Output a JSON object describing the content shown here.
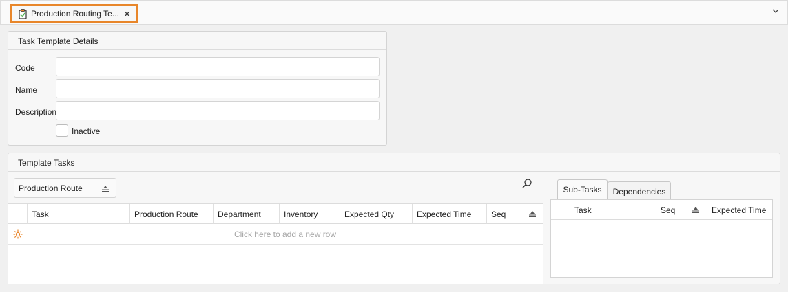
{
  "document_tab": {
    "title": "Production Routing Te...",
    "close_glyph": "✕"
  },
  "details": {
    "header": "Task Template Details",
    "code_label": "Code",
    "name_label": "Name",
    "description_label": "Description",
    "inactive_label": "Inactive",
    "code_value": "",
    "name_value": "",
    "description_value": ""
  },
  "template_tasks": {
    "header": "Template Tasks",
    "group_button_label": "Production Route",
    "columns": [
      "Task",
      "Production Route",
      "Department",
      "Inventory",
      "Expected Qty",
      "Expected Time",
      "Seq"
    ],
    "new_row_hint": "Click here to add a new row"
  },
  "sub_panel": {
    "tabs": [
      "Sub-Tasks",
      "Dependencies"
    ],
    "active_tab": "Sub-Tasks",
    "columns": [
      "Task",
      "Seq",
      "Expected Time"
    ]
  },
  "colors": {
    "accent": "#e8862a",
    "icon_green": "#4caf50"
  }
}
